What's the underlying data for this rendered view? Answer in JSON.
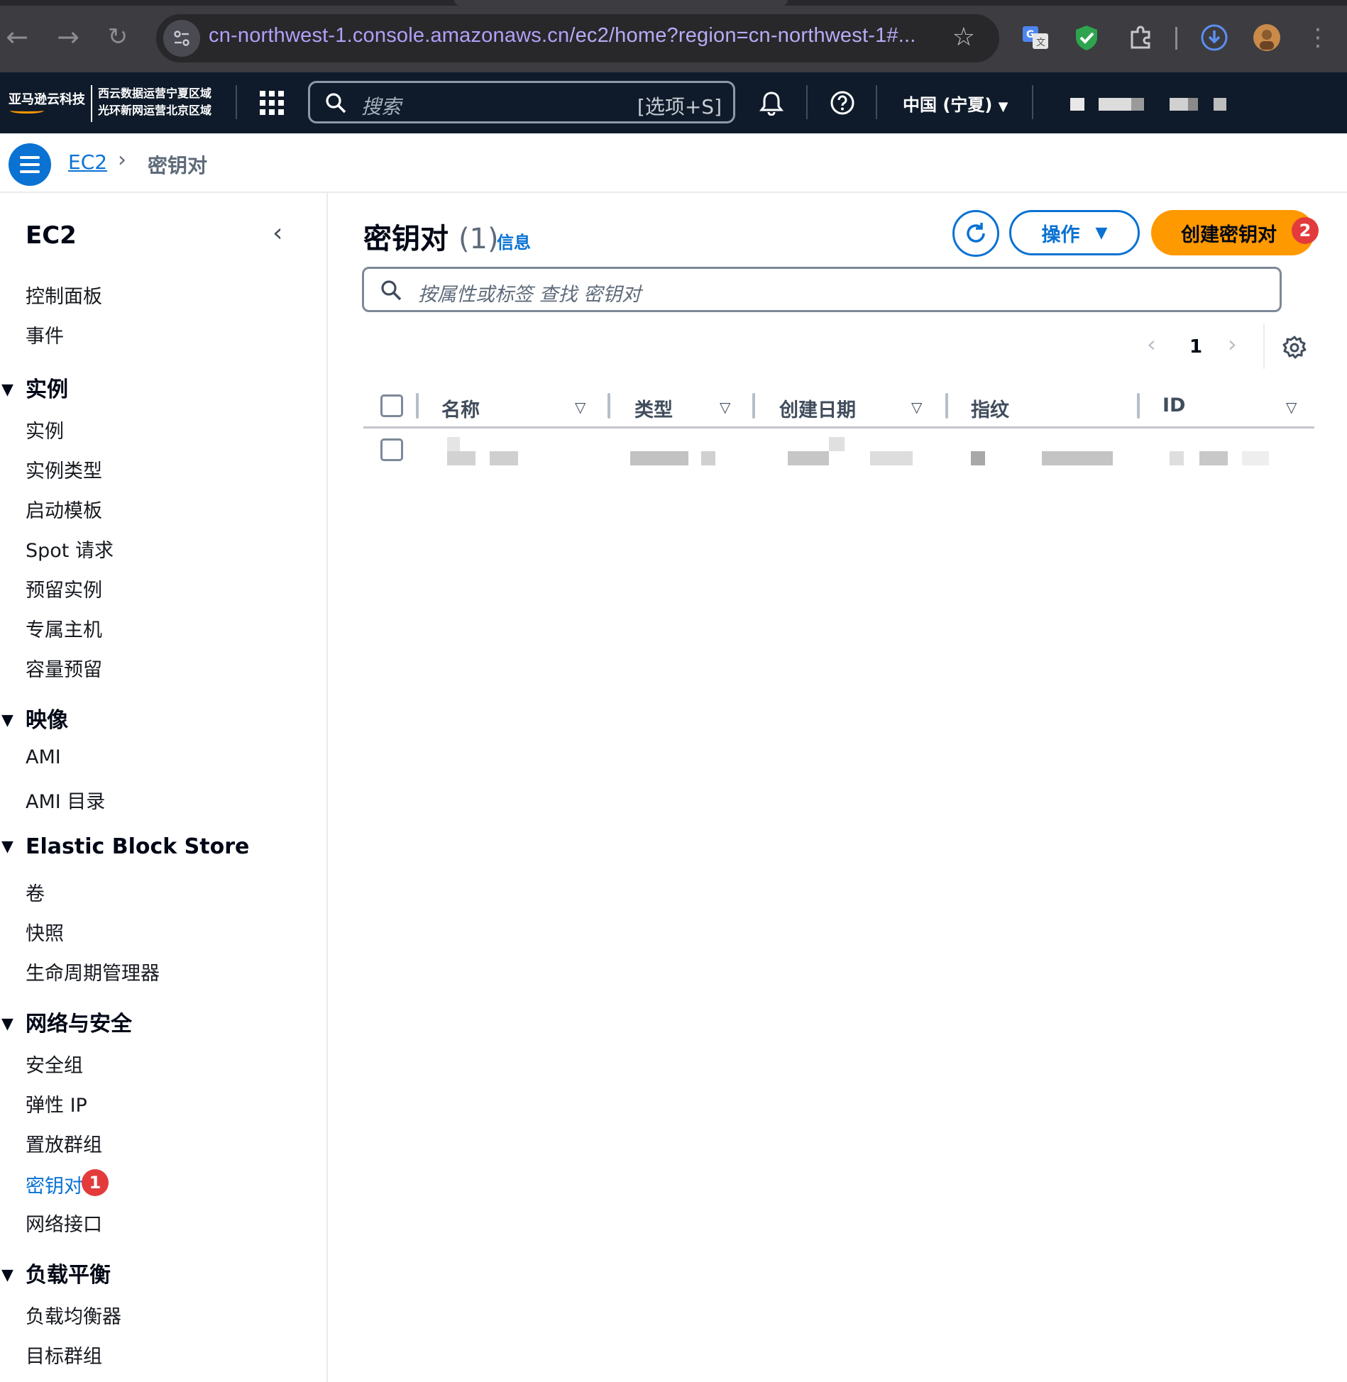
{
  "browser": {
    "url_host": "cn-northwest-1.console.amazonaws.cn",
    "url_path": "/ec2/home?region=cn-northwest-1#..."
  },
  "aws_nav": {
    "logo_text": "亚马逊云科技",
    "logo_sub_line1": "西云数据运营宁夏区域",
    "logo_sub_line2": "光环新网运营北京区域",
    "search_placeholder": "搜索",
    "search_shortcut": "[选项+S]",
    "region": "中国 (宁夏)"
  },
  "breadcrumb": {
    "root": "EC2",
    "current": "密钥对"
  },
  "sidebar": {
    "title": "EC2",
    "top_items": [
      "控制面板",
      "事件"
    ],
    "sections": [
      {
        "label": "实例",
        "items": [
          "实例",
          "实例类型",
          "启动模板",
          "Spot 请求",
          "预留实例",
          "专属主机",
          "容量预留"
        ]
      },
      {
        "label": "映像",
        "items": [
          "AMI",
          "AMI 目录"
        ]
      },
      {
        "label": "Elastic Block Store",
        "items": [
          "卷",
          "快照",
          "生命周期管理器"
        ]
      },
      {
        "label": "网络与安全",
        "items": [
          "安全组",
          "弹性 IP",
          "置放群组",
          "密钥对",
          "网络接口"
        ]
      },
      {
        "label": "负载平衡",
        "items": [
          "负载均衡器",
          "目标群组"
        ]
      }
    ],
    "active_badge": "1"
  },
  "main": {
    "title": "密钥对",
    "count": "(1)",
    "info": "信息",
    "actions_label": "操作",
    "create_label": "创建密钥对",
    "create_badge": "2",
    "filter_placeholder": "按属性或标签 查找 密钥对",
    "page": "1",
    "columns": [
      "名称",
      "类型",
      "创建日期",
      "指纹",
      "ID"
    ]
  },
  "colors": {
    "primary": "#0972d3",
    "cta": "#ff9900",
    "badge": "#e33b3b",
    "nav_bg": "#0f1b2a"
  }
}
